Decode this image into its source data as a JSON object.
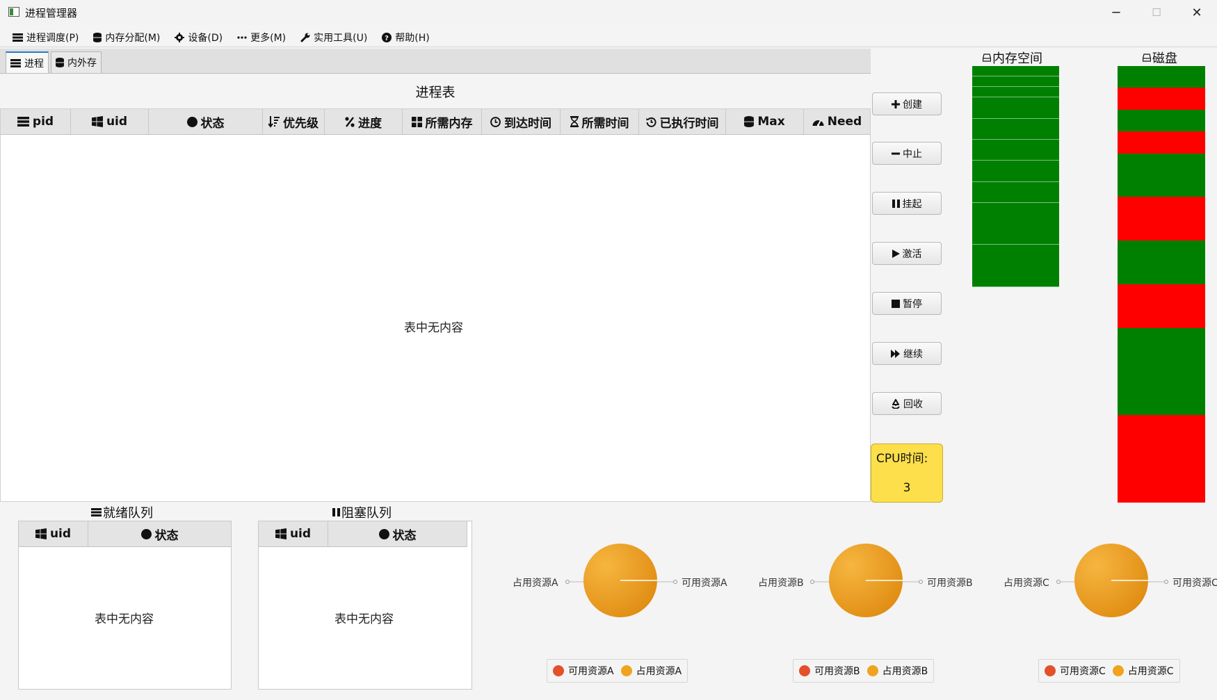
{
  "window": {
    "title": "进程管理器",
    "minimize_glyph": "─",
    "maximize_glyph": "☐",
    "close_glyph": "✕"
  },
  "menu": [
    {
      "label": "进程调度(P)",
      "icon": "list-icon"
    },
    {
      "label": "内存分配(M)",
      "icon": "database-icon"
    },
    {
      "label": "设备(D)",
      "icon": "gear-icon"
    },
    {
      "label": "更多(M)",
      "icon": "ellipsis-icon"
    },
    {
      "label": "实用工具(U)",
      "icon": "wrench-icon"
    },
    {
      "label": "帮助(H)",
      "icon": "question-icon"
    }
  ],
  "tabs": [
    {
      "label": "进程",
      "icon": "list-icon",
      "active": true
    },
    {
      "label": "内外存",
      "icon": "database-icon",
      "active": false
    }
  ],
  "process_table": {
    "title": "进程表",
    "columns": [
      {
        "label": "pid",
        "icon": "list-icon"
      },
      {
        "label": "uid",
        "icon": "windows-icon"
      },
      {
        "label": "状态",
        "icon": "circle-icon"
      },
      {
        "label": "优先级",
        "icon": "sort-icon"
      },
      {
        "label": "进度",
        "icon": "percent-icon"
      },
      {
        "label": "所需内存",
        "icon": "grid-icon"
      },
      {
        "label": "到达时间",
        "icon": "clock-icon"
      },
      {
        "label": "所需时间",
        "icon": "hourglass-icon"
      },
      {
        "label": "已执行时间",
        "icon": "history-icon"
      },
      {
        "label": "Max",
        "icon": "database-icon"
      },
      {
        "label": "Need",
        "icon": "dashboard-icon"
      }
    ],
    "rows": [],
    "empty_text": "表中无内容"
  },
  "controls": {
    "create": "创建",
    "stop": "中止",
    "suspend": "挂起",
    "activate": "激活",
    "pause": "暂停",
    "resume": "继续",
    "recycle": "回收"
  },
  "cpu": {
    "label": "CPU时间:",
    "value": "3"
  },
  "memory": {
    "title": "内存空间",
    "blocks": [
      {
        "state": "used",
        "size": 1
      },
      {
        "state": "used",
        "size": 1
      },
      {
        "state": "used",
        "size": 1
      },
      {
        "state": "used",
        "size": 2
      },
      {
        "state": "used",
        "size": 2
      },
      {
        "state": "used",
        "size": 2
      },
      {
        "state": "used",
        "size": 2
      },
      {
        "state": "used",
        "size": 2
      },
      {
        "state": "used",
        "size": 4
      },
      {
        "state": "used",
        "size": 4
      }
    ]
  },
  "disk": {
    "title": "磁盘",
    "blocks": [
      {
        "state": "free",
        "size": 1
      },
      {
        "state": "used",
        "size": 1
      },
      {
        "state": "free",
        "size": 1
      },
      {
        "state": "used",
        "size": 1
      },
      {
        "state": "free",
        "size": 2
      },
      {
        "state": "used",
        "size": 2
      },
      {
        "state": "free",
        "size": 2
      },
      {
        "state": "used",
        "size": 2
      },
      {
        "state": "free",
        "size": 4
      },
      {
        "state": "used",
        "size": 4
      }
    ]
  },
  "ready_queue": {
    "title": "就绪队列",
    "columns": [
      "uid",
      "状态"
    ],
    "rows": [],
    "empty_text": "表中无内容"
  },
  "blocked_queue": {
    "title": "阻塞队列",
    "columns": [
      "uid",
      "状态"
    ],
    "rows": [],
    "empty_text": "表中无内容"
  },
  "resources": [
    {
      "occupied_label": "占用资源A",
      "available_label": "可用资源A",
      "occupied": 1,
      "available": 0
    },
    {
      "occupied_label": "占用资源B",
      "available_label": "可用资源B",
      "occupied": 1,
      "available": 0
    },
    {
      "occupied_label": "占用资源C",
      "available_label": "可用资源C",
      "occupied": 1,
      "available": 0
    }
  ],
  "colors": {
    "green": "#008000",
    "red": "#ff0000",
    "pie_occupied": "#f0a31f",
    "pie_available": "#e2512b",
    "cpu_box": "#fcdf4a"
  }
}
